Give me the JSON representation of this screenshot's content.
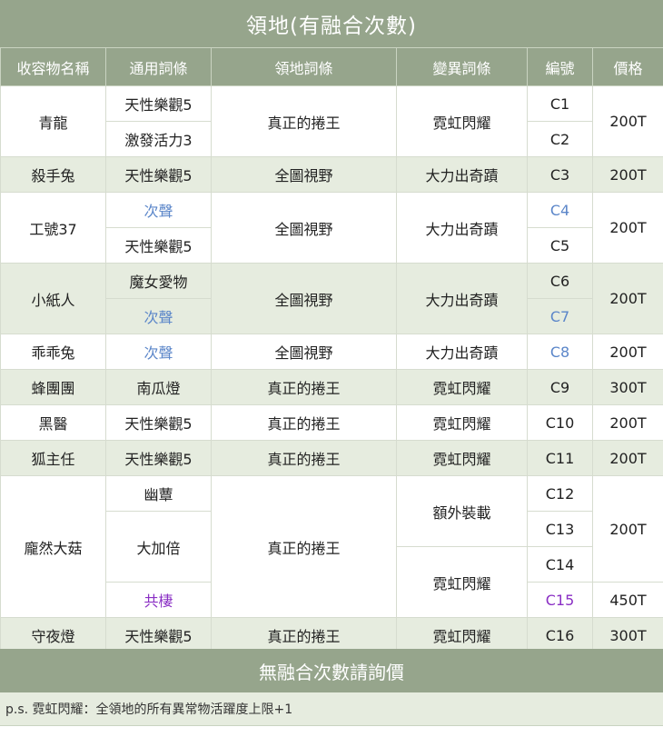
{
  "title": "領地(有融合次數)",
  "headers": [
    "收容物名稱",
    "通用詞條",
    "領地詞條",
    "變異詞條",
    "編號",
    "價格"
  ],
  "rows": {
    "qinglong": {
      "name": "青龍",
      "common1": "天性樂觀5",
      "common2": "激發活力3",
      "territory": "真正的捲王",
      "mutation": "霓虹閃耀",
      "code1": "C1",
      "code2": "C2",
      "price": "200T"
    },
    "shashou": {
      "name": "殺手兔",
      "common": "天性樂觀5",
      "territory": "全圖視野",
      "mutation": "大力出奇蹟",
      "code": "C3",
      "price": "200T"
    },
    "gonghao": {
      "name": "工號37",
      "common1": "次聲",
      "common2": "天性樂觀5",
      "territory": "全圖視野",
      "mutation": "大力出奇蹟",
      "code1": "C4",
      "code2": "C5",
      "price": "200T"
    },
    "xiaozhiren": {
      "name": "小紙人",
      "common1": "魔女愛物",
      "common2": "次聲",
      "territory": "全圖視野",
      "mutation": "大力出奇蹟",
      "code1": "C6",
      "code2": "C7",
      "price": "200T"
    },
    "guaiguai": {
      "name": "乖乖兔",
      "common": "次聲",
      "territory": "全圖視野",
      "mutation": "大力出奇蹟",
      "code": "C8",
      "price": "200T"
    },
    "fengtuan": {
      "name": "蜂團團",
      "common": "南瓜燈",
      "territory": "真正的捲王",
      "mutation": "霓虹閃耀",
      "code": "C9",
      "price": "300T"
    },
    "heiyi": {
      "name": "黑醫",
      "common": "天性樂觀5",
      "territory": "真正的捲王",
      "mutation": "霓虹閃耀",
      "code": "C10",
      "price": "200T"
    },
    "huzhuren": {
      "name": "狐主任",
      "common": "天性樂觀5",
      "territory": "真正的捲王",
      "mutation": "霓虹閃耀",
      "code": "C11",
      "price": "200T"
    },
    "pangran": {
      "name": "龐然大菇",
      "common1": "幽蕈",
      "common2": "大加倍",
      "common3": "共棲",
      "territory": "真正的捲王",
      "mutation1": "額外裝載",
      "mutation2": "霓虹閃耀",
      "code1": "C12",
      "code2": "C13",
      "code3": "C14",
      "code4": "C15",
      "price1": "200T",
      "price2": "450T"
    },
    "shouye": {
      "name": "守夜燈",
      "common": "天性樂觀5",
      "territory": "真正的捲王",
      "mutation": "霓虹閃耀",
      "code": "C16",
      "price": "300T"
    }
  },
  "footer": "無融合次數請詢價",
  "note": "p.s. 霓虹閃耀：全領地的所有異常物活躍度上限+1"
}
